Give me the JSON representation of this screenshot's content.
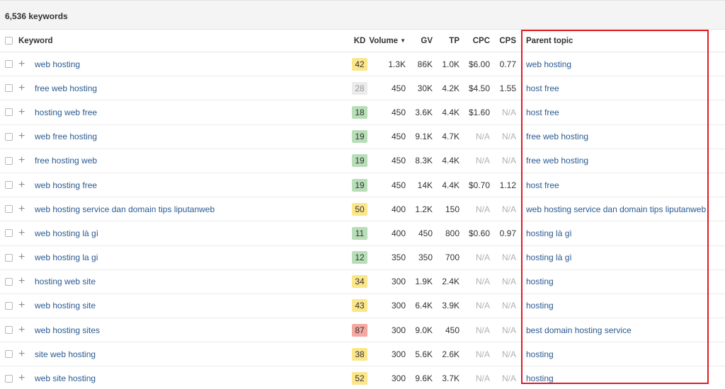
{
  "summary": {
    "keyword_count": "6,536 keywords"
  },
  "columns": {
    "keyword": "Keyword",
    "kd": "KD",
    "volume": "Volume",
    "gv": "GV",
    "tp": "TP",
    "cpc": "CPC",
    "cps": "CPS",
    "parent_topic": "Parent topic"
  },
  "icons": {
    "sort": "sort-down-icon",
    "add": "plus-icon"
  },
  "kd_colors": {
    "light": "#ebebeb",
    "green": "#b8deb8",
    "yellow": "#fbe68a",
    "red": "#f4a8a0"
  },
  "highlight_color": "#e01b24",
  "rows": [
    {
      "keyword": "web hosting",
      "kd": "42",
      "kd_level": "yellow",
      "volume": "1.3K",
      "gv": "86K",
      "tp": "1.0K",
      "cpc": "$6.00",
      "cps": "0.77",
      "parent_topic": "web hosting"
    },
    {
      "keyword": "free web hosting",
      "kd": "28",
      "kd_level": "light",
      "volume": "450",
      "gv": "30K",
      "tp": "4.2K",
      "cpc": "$4.50",
      "cps": "1.55",
      "parent_topic": "host free"
    },
    {
      "keyword": "hosting web free",
      "kd": "18",
      "kd_level": "green",
      "volume": "450",
      "gv": "3.6K",
      "tp": "4.4K",
      "cpc": "$1.60",
      "cps": "N/A",
      "parent_topic": "host free"
    },
    {
      "keyword": "web free hosting",
      "kd": "19",
      "kd_level": "green",
      "volume": "450",
      "gv": "9.1K",
      "tp": "4.7K",
      "cpc": "N/A",
      "cps": "N/A",
      "parent_topic": "free web hosting"
    },
    {
      "keyword": "free hosting web",
      "kd": "19",
      "kd_level": "green",
      "volume": "450",
      "gv": "8.3K",
      "tp": "4.4K",
      "cpc": "N/A",
      "cps": "N/A",
      "parent_topic": "free web hosting"
    },
    {
      "keyword": "web hosting free",
      "kd": "19",
      "kd_level": "green",
      "volume": "450",
      "gv": "14K",
      "tp": "4.4K",
      "cpc": "$0.70",
      "cps": "1.12",
      "parent_topic": "host free"
    },
    {
      "keyword": "web hosting service dan domain tips liputanweb",
      "kd": "50",
      "kd_level": "yellow",
      "volume": "400",
      "gv": "1.2K",
      "tp": "150",
      "cpc": "N/A",
      "cps": "N/A",
      "parent_topic": "web hosting service dan domain tips liputanweb"
    },
    {
      "keyword": "web hosting là gì",
      "kd": "11",
      "kd_level": "green",
      "volume": "400",
      "gv": "450",
      "tp": "800",
      "cpc": "$0.60",
      "cps": "0.97",
      "parent_topic": "hosting là gì"
    },
    {
      "keyword": "web hosting la gi",
      "kd": "12",
      "kd_level": "green",
      "volume": "350",
      "gv": "350",
      "tp": "700",
      "cpc": "N/A",
      "cps": "N/A",
      "parent_topic": "hosting là gì"
    },
    {
      "keyword": "hosting web site",
      "kd": "34",
      "kd_level": "yellow",
      "volume": "300",
      "gv": "1.9K",
      "tp": "2.4K",
      "cpc": "N/A",
      "cps": "N/A",
      "parent_topic": "hosting"
    },
    {
      "keyword": "web hosting site",
      "kd": "43",
      "kd_level": "yellow",
      "volume": "300",
      "gv": "6.4K",
      "tp": "3.9K",
      "cpc": "N/A",
      "cps": "N/A",
      "parent_topic": "hosting"
    },
    {
      "keyword": "web hosting sites",
      "kd": "87",
      "kd_level": "red",
      "volume": "300",
      "gv": "9.0K",
      "tp": "450",
      "cpc": "N/A",
      "cps": "N/A",
      "parent_topic": "best domain hosting service"
    },
    {
      "keyword": "site web hosting",
      "kd": "38",
      "kd_level": "yellow",
      "volume": "300",
      "gv": "5.6K",
      "tp": "2.6K",
      "cpc": "N/A",
      "cps": "N/A",
      "parent_topic": "hosting"
    },
    {
      "keyword": "web site hosting",
      "kd": "52",
      "kd_level": "yellow",
      "volume": "300",
      "gv": "9.6K",
      "tp": "3.7K",
      "cpc": "N/A",
      "cps": "N/A",
      "parent_topic": "hosting"
    }
  ]
}
